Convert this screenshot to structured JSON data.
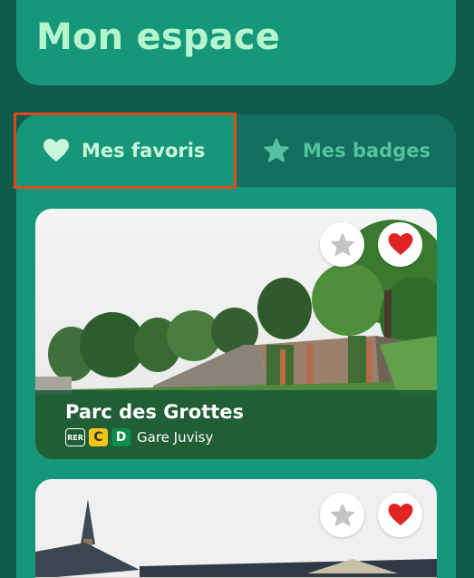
{
  "header": {
    "title": "Mon espace"
  },
  "tabs": [
    {
      "label": "Mes favoris",
      "icon": "heart-icon",
      "active": true
    },
    {
      "label": "Mes badges",
      "icon": "star-icon",
      "active": false
    }
  ],
  "colors": {
    "background": "#0f5c4d",
    "panel": "#16977a",
    "title": "#b6f6cd",
    "highlight": "#e04a1b",
    "heart": "#e02424"
  },
  "places": [
    {
      "name": "Parc des Grottes",
      "transit": {
        "mode": "RER",
        "lines": [
          "C",
          "D"
        ],
        "station": "Gare Juvisy"
      },
      "favorite": true
    },
    {
      "name": "",
      "favorite": true
    }
  ]
}
